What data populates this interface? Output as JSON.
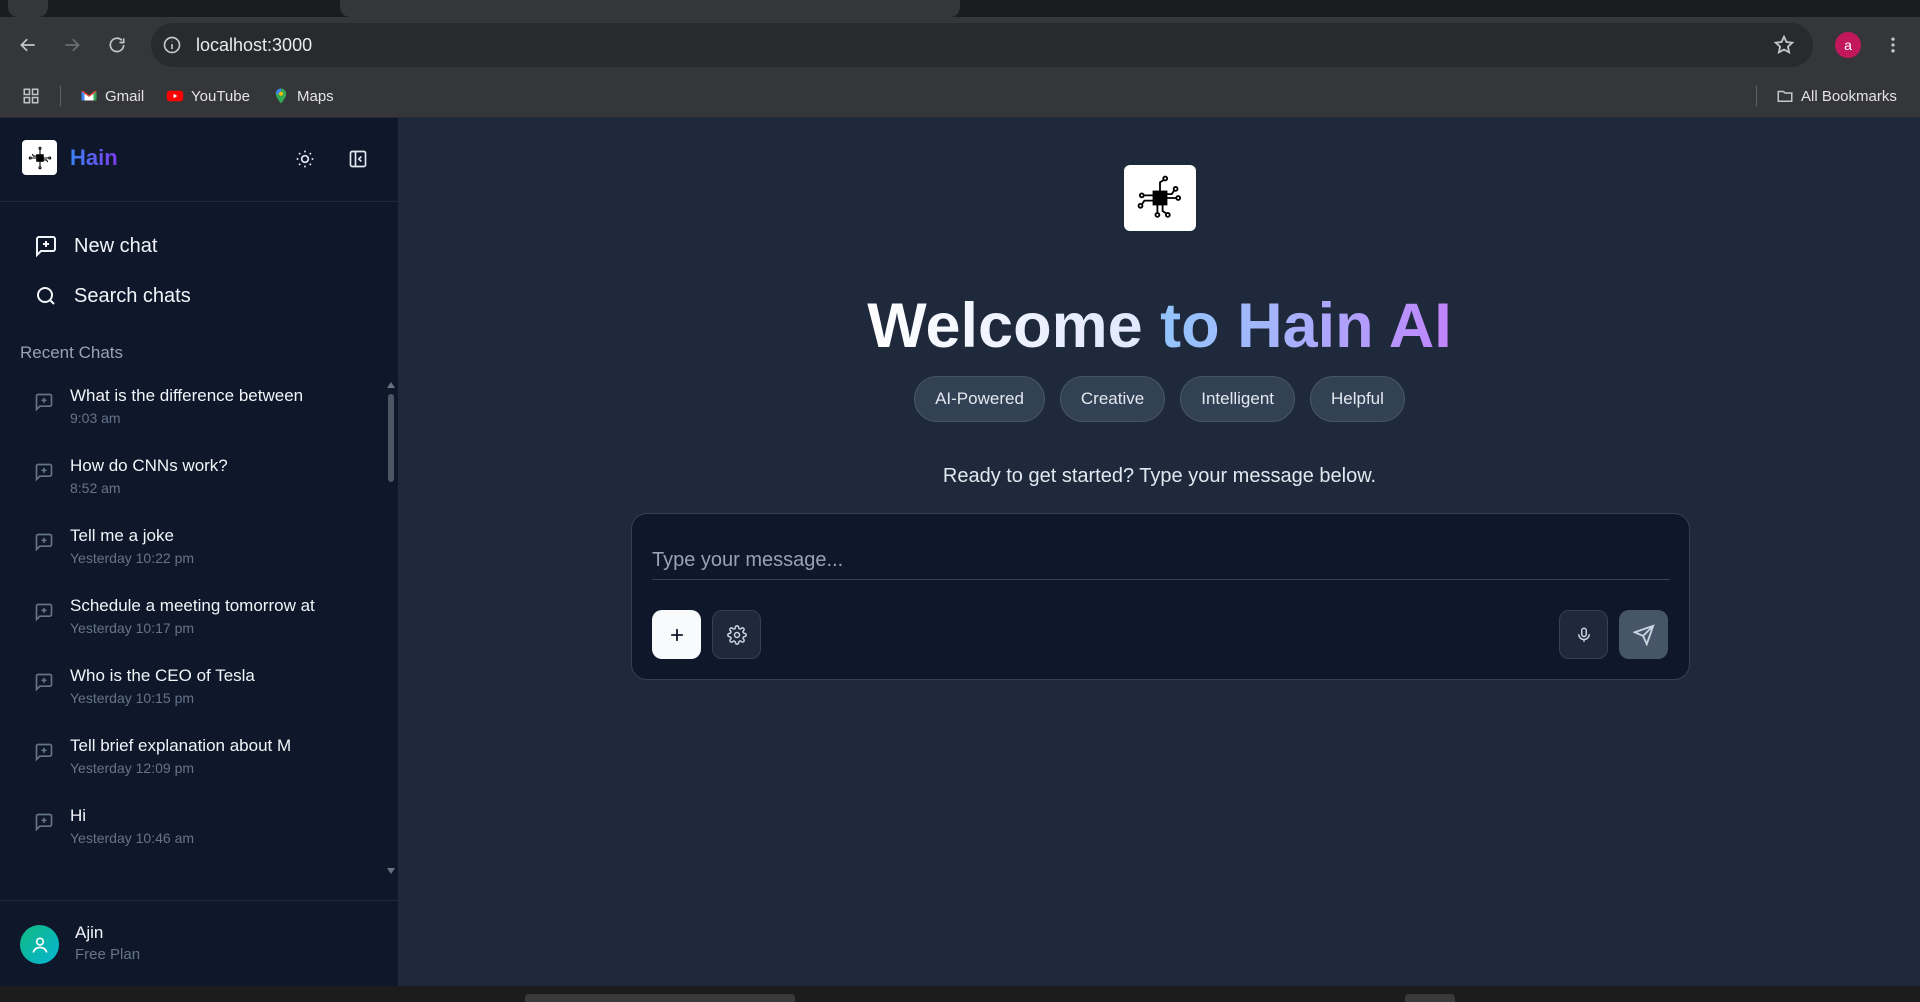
{
  "browser": {
    "url": "localhost:3000",
    "profile_initial": "a",
    "bookmarks": [
      {
        "label": "Gmail",
        "icon": "gmail-icon"
      },
      {
        "label": "YouTube",
        "icon": "youtube-icon"
      },
      {
        "label": "Maps",
        "icon": "maps-icon"
      }
    ],
    "all_bookmarks_label": "All Bookmarks",
    "colors": {
      "profile_avatar": "#c2185b"
    }
  },
  "sidebar": {
    "brand_name": "Hain",
    "new_chat_label": "New chat",
    "search_chats_label": "Search chats",
    "recent_label": "Recent Chats",
    "chats": [
      {
        "title": "What is the difference between",
        "time": "9:03 am"
      },
      {
        "title": "How do CNNs work?",
        "time": "8:52 am"
      },
      {
        "title": "Tell me a joke",
        "time": "Yesterday 10:22 pm"
      },
      {
        "title": "Schedule a meeting tomorrow at",
        "time": "Yesterday 10:17 pm"
      },
      {
        "title": "Who is the CEO of Tesla",
        "time": "Yesterday 10:15 pm"
      },
      {
        "title": "Tell brief explanation about M",
        "time": "Yesterday 12:09 pm"
      },
      {
        "title": "Hi",
        "time": "Yesterday 10:46 am"
      }
    ],
    "user": {
      "name": "Ajin",
      "plan": "Free Plan"
    }
  },
  "main": {
    "welcome_part1": "Welcome",
    "welcome_part2": "to Hain AI",
    "tags": [
      "AI-Powered",
      "Creative",
      "Intelligent",
      "Helpful"
    ],
    "subtitle": "Ready to get started? Type your message below.",
    "input_placeholder": "Type your message...",
    "colors": {
      "background": "#1e293b",
      "sidebar": "#0f172a",
      "brand_gradient_start": "#3b82f6",
      "brand_gradient_end": "#7c3aed"
    }
  }
}
